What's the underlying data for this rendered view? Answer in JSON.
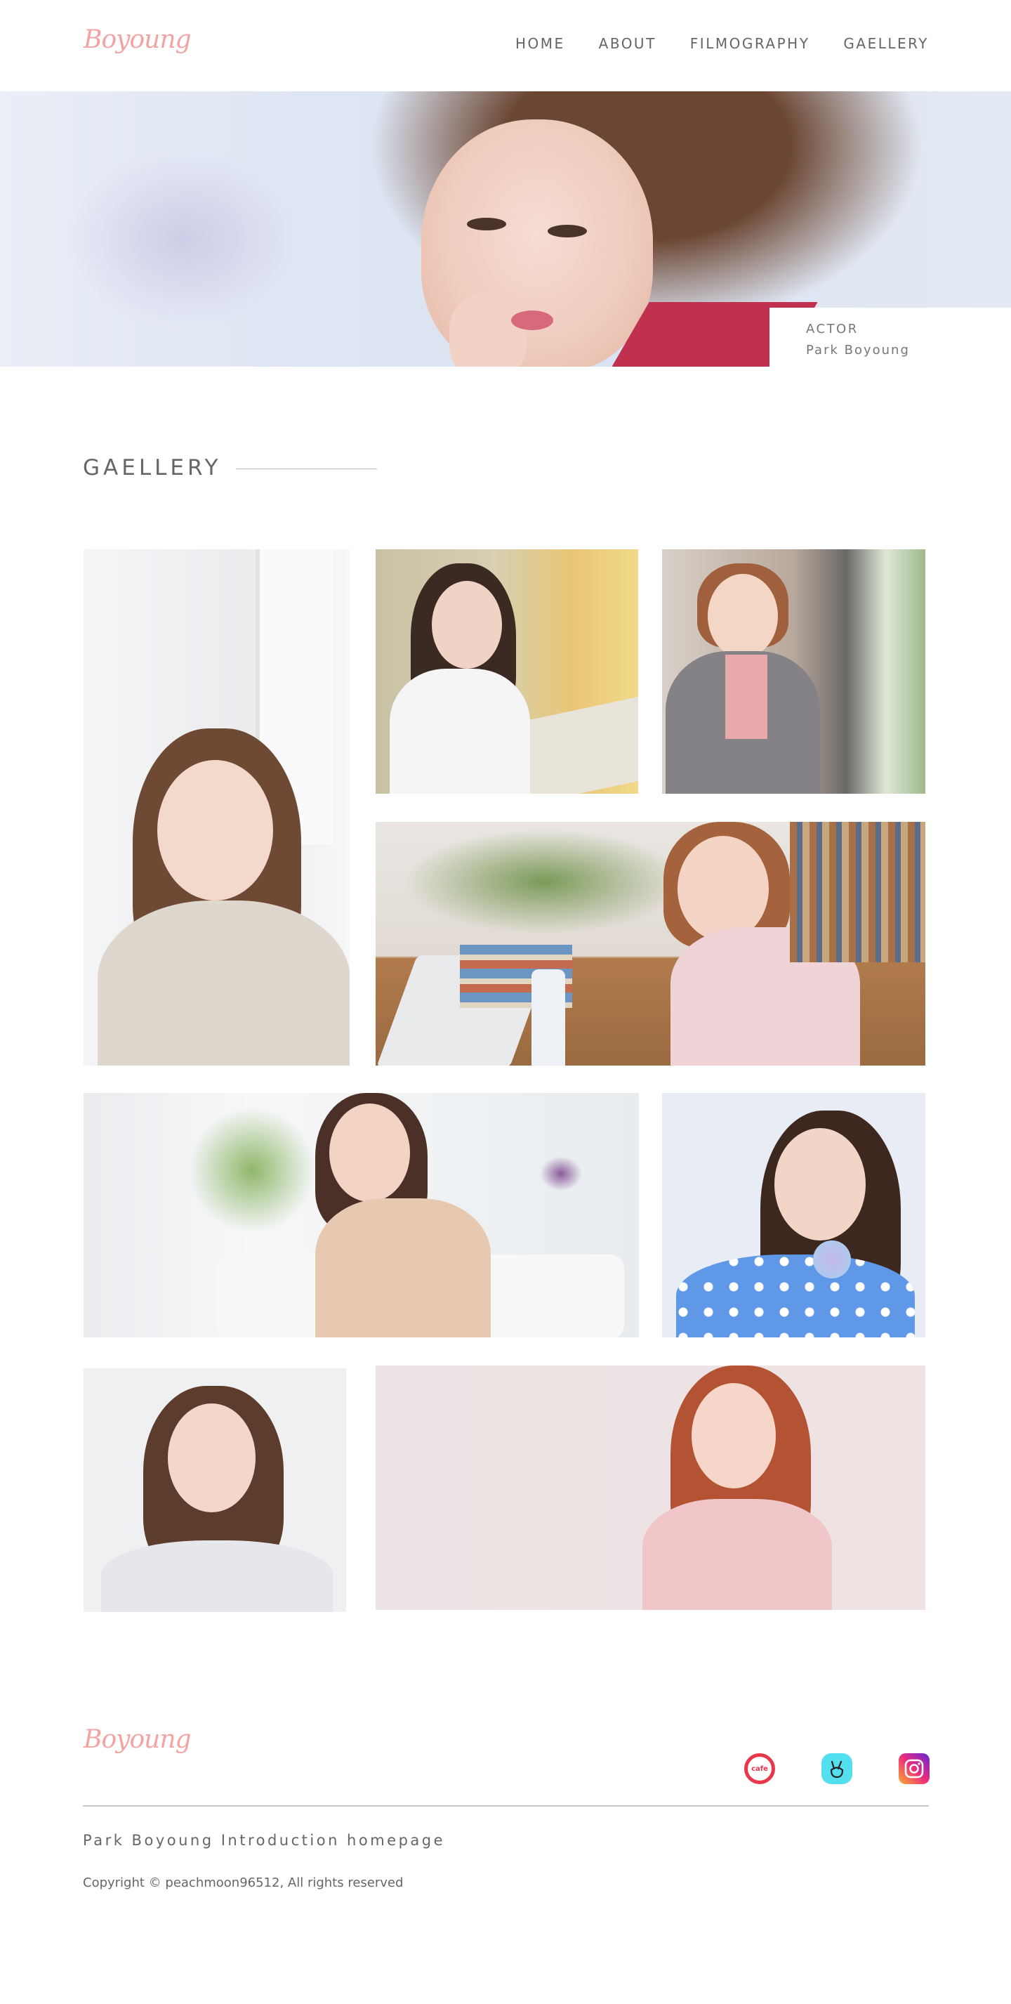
{
  "header": {
    "logo": "Boyoung",
    "nav": [
      "HOME",
      "ABOUT",
      "FILMOGRAPHY",
      "GAELLERY"
    ]
  },
  "hero": {
    "label": "ACTOR",
    "name": "Park Boyoung"
  },
  "gallery": {
    "title": "GAELLERY"
  },
  "footer": {
    "logo": "Boyoung",
    "social": [
      "cafe",
      "vlive-icon",
      "instagram-icon"
    ],
    "cafe_text": "cafe",
    "intro": "Park Boyoung Introduction homepage",
    "copyright": "Copyright © peachmoon96512, All rights reserved"
  },
  "colors": {
    "accent": "#f2a4a4",
    "text": "#666666"
  }
}
